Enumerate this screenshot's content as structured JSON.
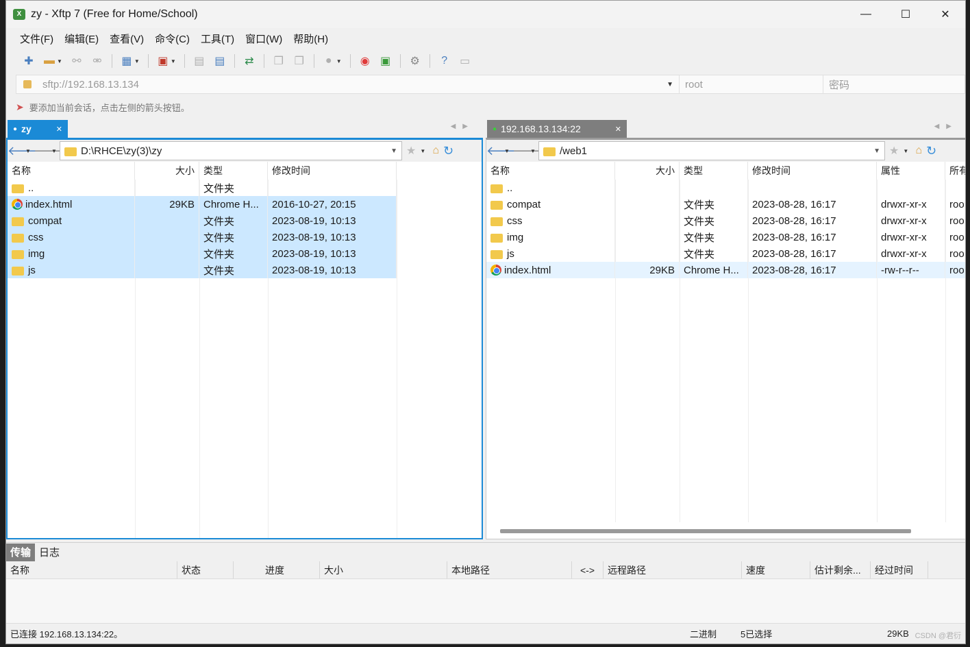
{
  "window": {
    "title": "zy - Xftp 7 (Free for Home/School)",
    "controls": [
      "—",
      "☐",
      "✕"
    ]
  },
  "menu": [
    "文件(F)",
    "编辑(E)",
    "查看(V)",
    "命令(C)",
    "工具(T)",
    "窗口(W)",
    "帮助(H)"
  ],
  "address": {
    "url": "sftp://192.168.13.134",
    "user_placeholder": "root",
    "password_placeholder": "密码"
  },
  "hint": "要添加当前会话，点击左侧的箭头按钮。",
  "left_pane": {
    "tab_label": "zy",
    "path": "D:\\RHCE\\zy(3)\\zy",
    "columns": [
      "名称",
      "大小",
      "类型",
      "修改时间"
    ],
    "rows": [
      {
        "name": "..",
        "size": "",
        "type": "文件夹",
        "modified": "",
        "icon": "folder-icon"
      },
      {
        "name": "index.html",
        "size": "29KB",
        "type": "Chrome H...",
        "modified": "2016-10-27, 20:15",
        "icon": "chrome-icon"
      },
      {
        "name": "compat",
        "size": "",
        "type": "文件夹",
        "modified": "2023-08-19, 10:13",
        "icon": "folder-icon"
      },
      {
        "name": "css",
        "size": "",
        "type": "文件夹",
        "modified": "2023-08-19, 10:13",
        "icon": "folder-icon"
      },
      {
        "name": "img",
        "size": "",
        "type": "文件夹",
        "modified": "2023-08-19, 10:13",
        "icon": "folder-icon"
      },
      {
        "name": "js",
        "size": "",
        "type": "文件夹",
        "modified": "2023-08-19, 10:13",
        "icon": "folder-icon"
      }
    ]
  },
  "right_pane": {
    "tab_label": "192.168.13.134:22",
    "path": "/web1",
    "columns": [
      "名称",
      "大小",
      "类型",
      "修改时间",
      "属性",
      "所有"
    ],
    "rows": [
      {
        "name": "..",
        "size": "",
        "type": "",
        "modified": "",
        "attr": "",
        "owner": "",
        "icon": "folder-icon"
      },
      {
        "name": "compat",
        "size": "",
        "type": "文件夹",
        "modified": "2023-08-28, 16:17",
        "attr": "drwxr-xr-x",
        "owner": "roo",
        "icon": "folder-icon"
      },
      {
        "name": "css",
        "size": "",
        "type": "文件夹",
        "modified": "2023-08-28, 16:17",
        "attr": "drwxr-xr-x",
        "owner": "roo",
        "icon": "folder-icon"
      },
      {
        "name": "img",
        "size": "",
        "type": "文件夹",
        "modified": "2023-08-28, 16:17",
        "attr": "drwxr-xr-x",
        "owner": "roo",
        "icon": "folder-icon"
      },
      {
        "name": "js",
        "size": "",
        "type": "文件夹",
        "modified": "2023-08-28, 16:17",
        "attr": "drwxr-xr-x",
        "owner": "roo",
        "icon": "folder-icon"
      },
      {
        "name": "index.html",
        "size": "29KB",
        "type": "Chrome H...",
        "modified": "2023-08-28, 16:17",
        "attr": "-rw-r--r--",
        "owner": "roo",
        "icon": "chrome-icon"
      }
    ]
  },
  "bottom": {
    "tabs": [
      "传输",
      "日志"
    ],
    "columns": [
      "名称",
      "状态",
      "进度",
      "大小",
      "本地路径",
      "<->",
      "远程路径",
      "速度",
      "估计剩余...",
      "经过时间"
    ]
  },
  "status": {
    "connection": "已连接 192.168.13.134:22。",
    "mode": "二进制",
    "selection": "5已选择",
    "size": "29KB"
  },
  "watermark": "CSDN @君衍",
  "colors": {
    "accent": "#1b8ad6",
    "selection": "#cce8ff",
    "folder": "#f2c94c"
  }
}
